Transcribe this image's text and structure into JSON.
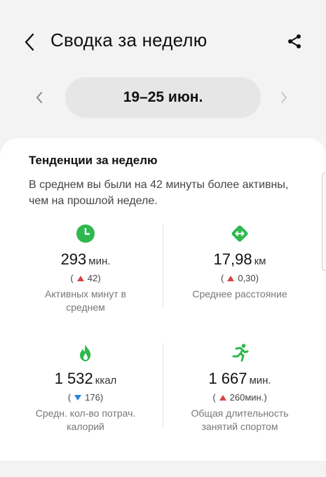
{
  "header": {
    "title": "Сводка за неделю"
  },
  "date_nav": {
    "range": "19–25 июн."
  },
  "trends": {
    "title": "Тенденции за неделю",
    "description": "В среднем вы были на 42 минуты более активны, чем на прошлой неделе."
  },
  "stats": [
    {
      "icon": "clock-icon",
      "value": "293",
      "unit": "мин.",
      "delta_open": "(",
      "delta_dir": "up",
      "delta": "42)",
      "label": "Активных минут в среднем",
      "icon_color": "#2fb84e"
    },
    {
      "icon": "distance-icon",
      "value": "17,98",
      "unit": "км",
      "delta_open": "(",
      "delta_dir": "up",
      "delta": "0,30)",
      "label": "Среднее расстояние",
      "icon_color": "#2fb84e"
    },
    {
      "icon": "flame-icon",
      "value": "1 532",
      "unit": "ккал",
      "delta_open": "(",
      "delta_dir": "down",
      "delta": "176)",
      "label": "Средн. кол-во потрач. калорий",
      "icon_color": "#2fb84e"
    },
    {
      "icon": "running-icon",
      "value": "1 667",
      "unit": "мин.",
      "delta_open": "(",
      "delta_dir": "up",
      "delta": "260мин.)",
      "label": "Общая длительность занятий спортом",
      "icon_color": "#2fb84e"
    }
  ],
  "colors": {
    "accent_green": "#2fb84e",
    "increase": "#d64541",
    "decrease": "#2f7fd8"
  }
}
